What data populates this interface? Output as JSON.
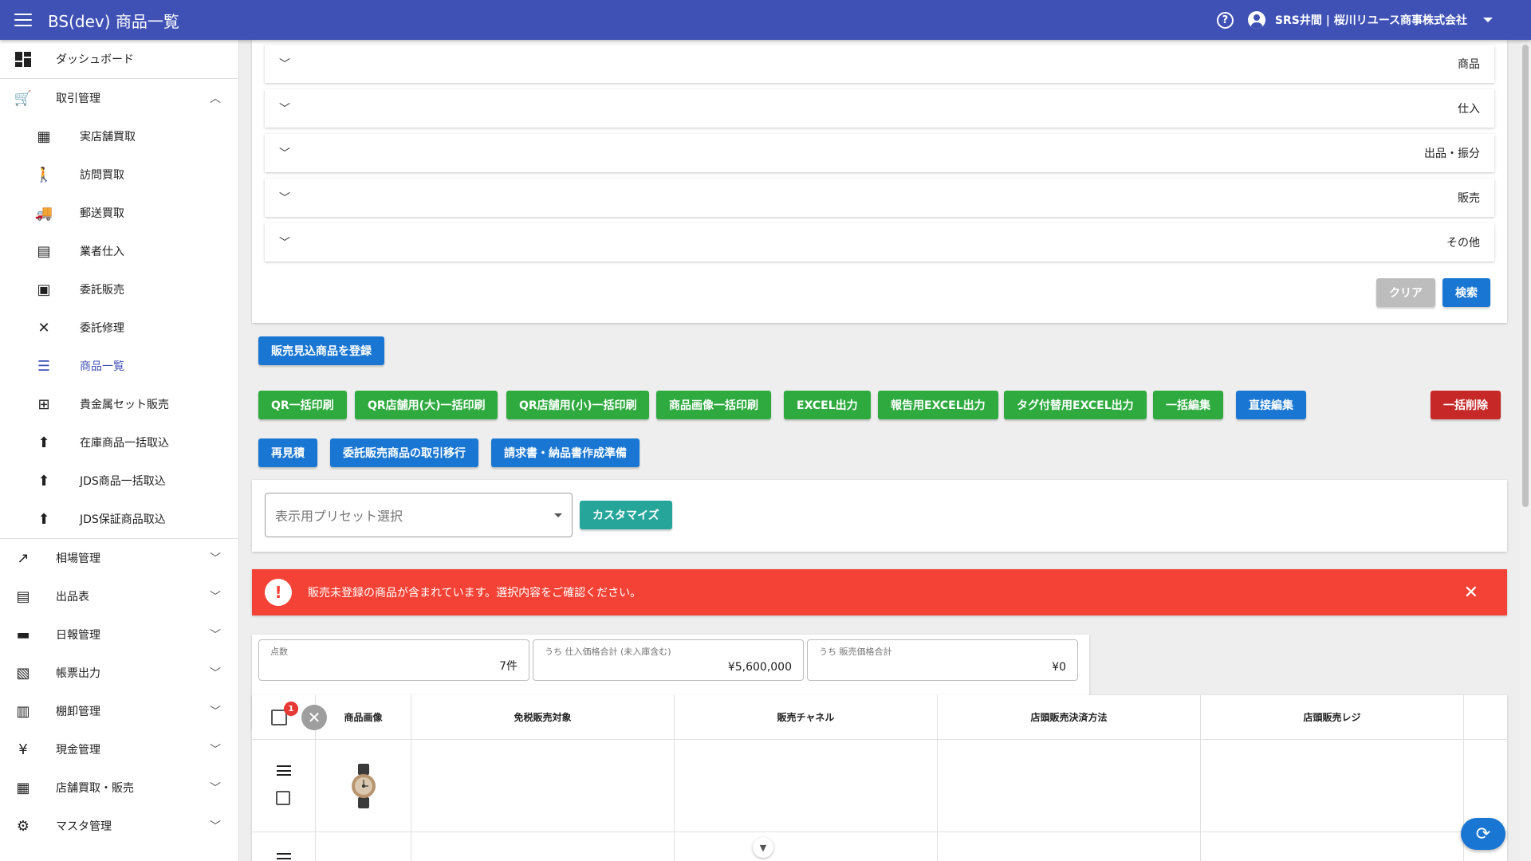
{
  "app": {
    "title": "BS(dev) 商品一覧",
    "user": "SRS井間 | 桜川リユース商事株式会社"
  },
  "sidebar": {
    "items": [
      {
        "label": "ダッシュボード",
        "icon": "dashboard-icon"
      },
      {
        "label": "取引管理",
        "icon": "cart-icon",
        "expanded": true
      },
      {
        "label": "実店舗買取",
        "icon": "store-icon"
      },
      {
        "label": "訪問買取",
        "icon": "walk-icon"
      },
      {
        "label": "郵送買取",
        "icon": "truck-icon"
      },
      {
        "label": "業者仕入",
        "icon": "building-icon"
      },
      {
        "label": "委託販売",
        "icon": "register-icon"
      },
      {
        "label": "委託修理",
        "icon": "tools-icon"
      },
      {
        "label": "商品一覧",
        "icon": "list-icon",
        "active": true
      },
      {
        "label": "貴金属セット販売",
        "icon": "grid-icon"
      },
      {
        "label": "在庫商品一括取込",
        "icon": "upload-icon"
      },
      {
        "label": "JDS商品一括取込",
        "icon": "upload-icon"
      },
      {
        "label": "JDS保証商品取込",
        "icon": "upload-icon"
      },
      {
        "label": "相場管理",
        "icon": "trending-icon"
      },
      {
        "label": "出品表",
        "icon": "listing-icon"
      },
      {
        "label": "日報管理",
        "icon": "document-icon"
      },
      {
        "label": "帳票出力",
        "icon": "report-icon"
      },
      {
        "label": "棚卸管理",
        "icon": "archive-icon"
      },
      {
        "label": "現金管理",
        "icon": "yen-icon"
      },
      {
        "label": "店舗買取・販売",
        "icon": "shop-icon"
      },
      {
        "label": "マスタ管理",
        "icon": "gear-icon"
      }
    ]
  },
  "search": {
    "sections": [
      "商品",
      "仕入",
      "出品・振分",
      "販売",
      "その他"
    ],
    "clear_label": "クリア",
    "search_label": "検索"
  },
  "actions": {
    "register": "販売見込商品を登録",
    "qr_bulk": "QR一括印刷",
    "qr_large": "QR店舗用(大)一括印刷",
    "qr_small": "QR店舗用(小)一括印刷",
    "image_bulk": "商品画像一括印刷",
    "excel": "EXCEL出力",
    "report_excel": "報告用EXCEL出力",
    "tag_excel": "タグ付替用EXCEL出力",
    "bulk_edit": "一括編集",
    "direct_edit": "直接編集",
    "bulk_delete": "一括削除",
    "reestimate": "再見積",
    "transfer": "委託販売商品の取引移行",
    "invoice": "請求書・納品書作成準備"
  },
  "preset": {
    "placeholder": "表示用プリセット選択",
    "customize": "カスタマイズ"
  },
  "alert": {
    "message": "販売未登録の商品が含まれています。選択内容をご確認ください。",
    "color": "#f44336"
  },
  "summary": {
    "count_label": "点数",
    "count_value": "7件",
    "purchase_label": "うち 仕入価格合計 (未入庫含む)",
    "purchase_value": "¥5,600,000",
    "sales_label": "うち 販売価格合計",
    "sales_value": "¥0"
  },
  "table": {
    "selected_count": "1",
    "headers": [
      "商品画像",
      "免税販売対象",
      "販売チャネル",
      "店頭販売決済方法",
      "店頭販売レジ"
    ]
  },
  "colors": {
    "appbar": "#3f51b5",
    "primary": "#1976d2",
    "success": "#2eaa3f",
    "danger": "#c62828",
    "teal": "#26a69a"
  }
}
